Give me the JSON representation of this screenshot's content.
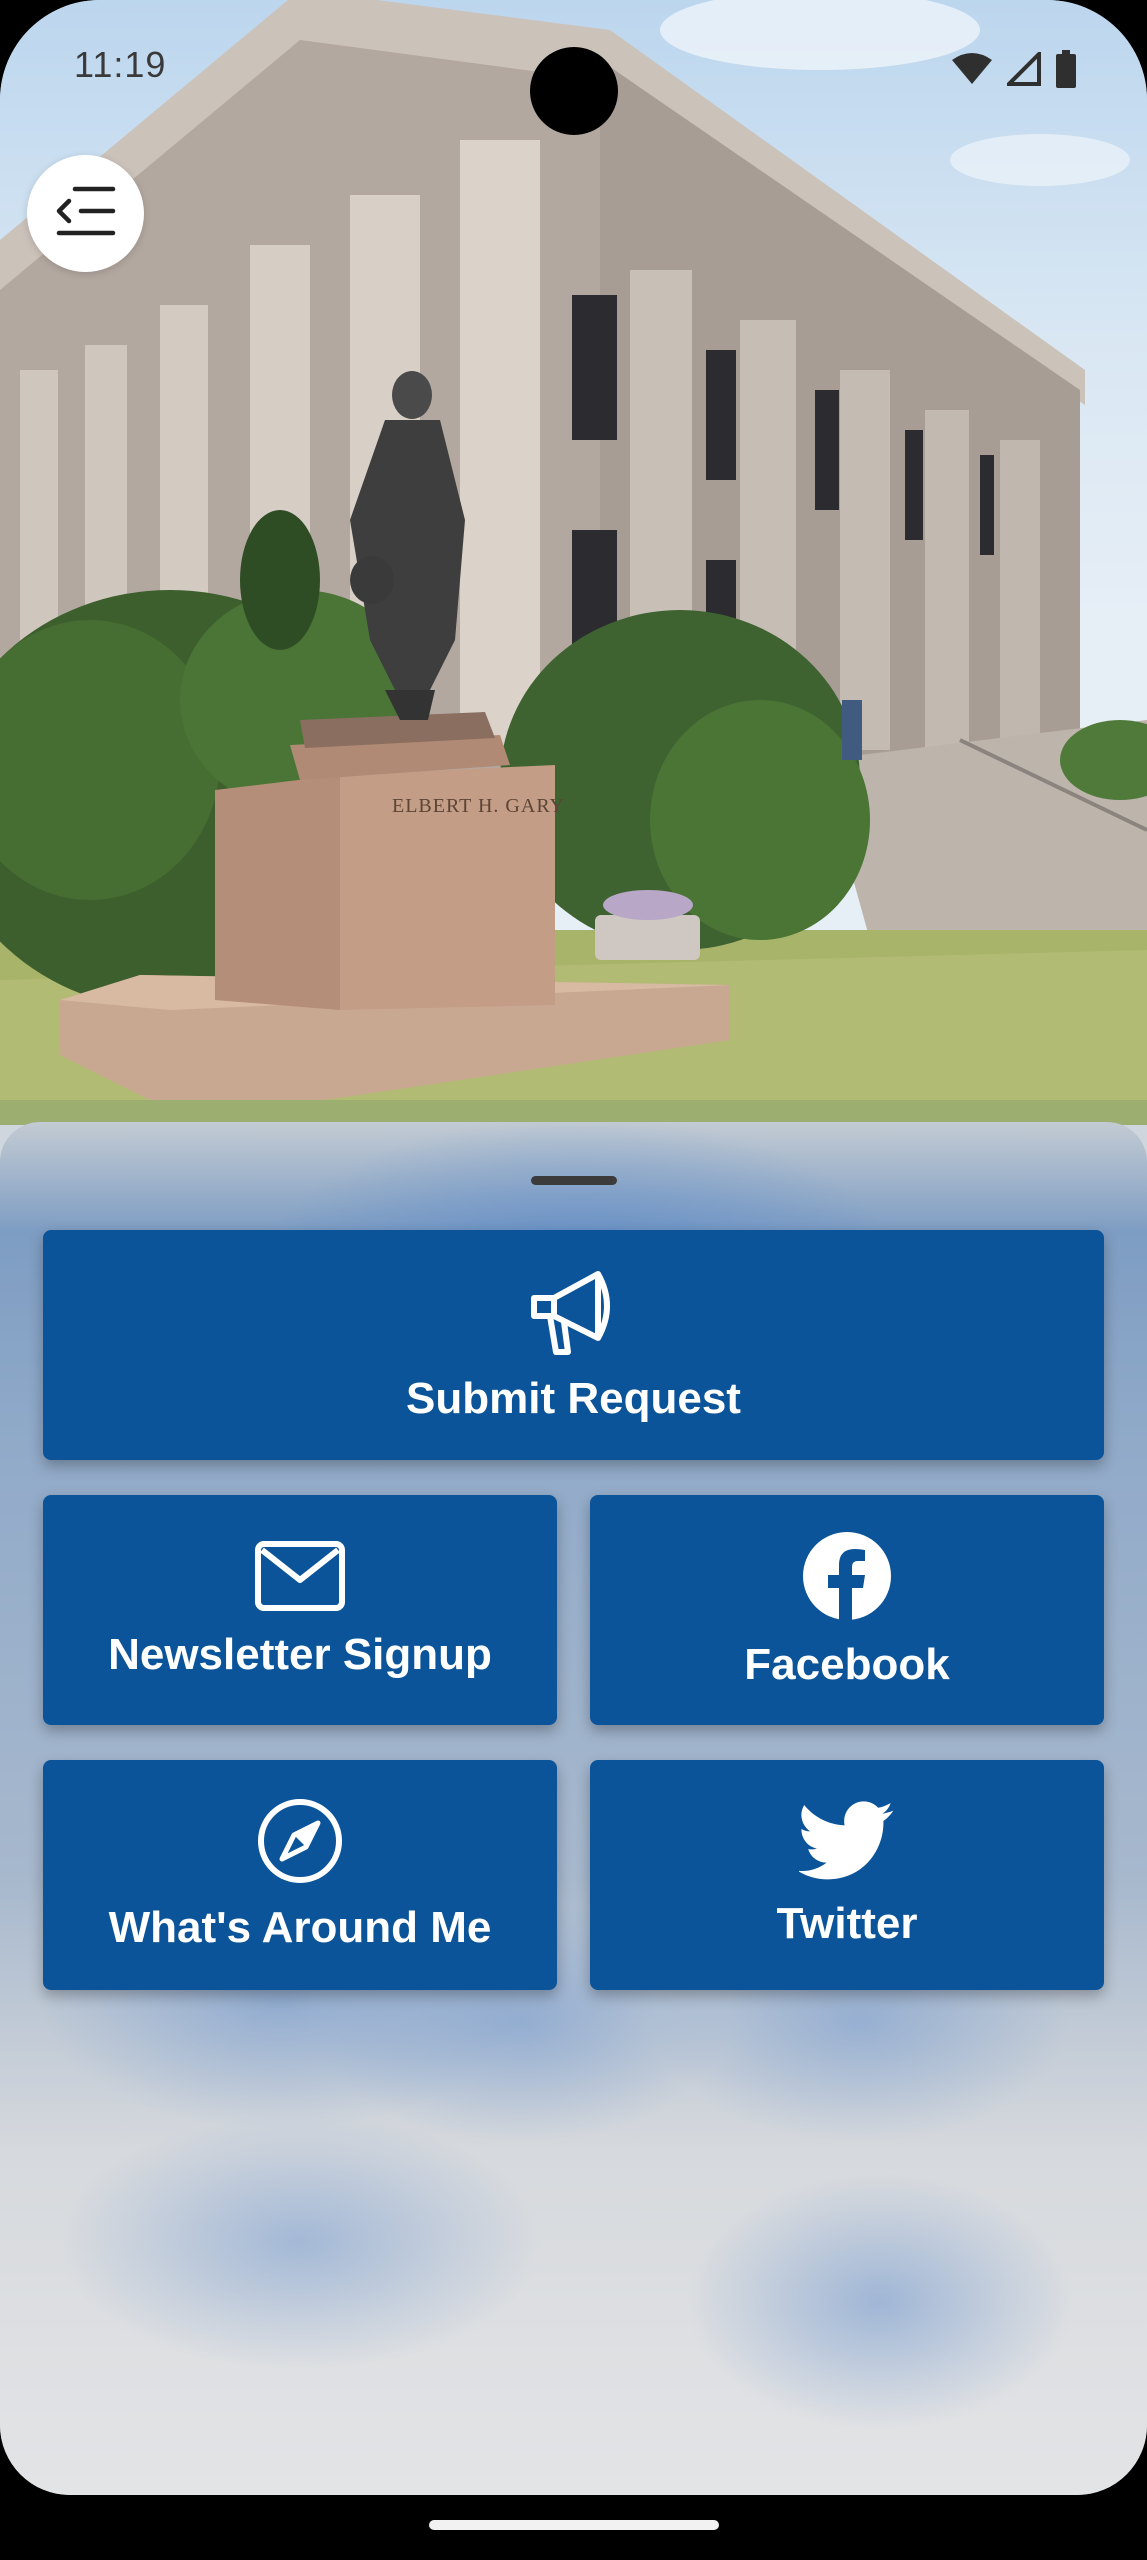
{
  "status_bar": {
    "time": "11:19",
    "wifi_icon": "wifi-icon",
    "signal_icon": "cell-signal-icon",
    "battery_icon": "battery-icon"
  },
  "header": {
    "menu_icon": "menu-icon",
    "hero_image": {
      "icon": "hero-photo",
      "pedestal_inscription": "ELBERT H. GARY"
    }
  },
  "sheet": {
    "tiles": [
      {
        "label": "Submit Request",
        "icon": "megaphone-icon"
      },
      {
        "label": "Newsletter Signup",
        "icon": "envelope-icon"
      },
      {
        "label": "Facebook",
        "icon": "facebook-icon"
      },
      {
        "label": "What's Around Me",
        "icon": "compass-icon"
      },
      {
        "label": "Twitter",
        "icon": "twitter-icon"
      }
    ]
  },
  "colors": {
    "tile_background": "#0b5499",
    "tile_text": "#ffffff"
  }
}
